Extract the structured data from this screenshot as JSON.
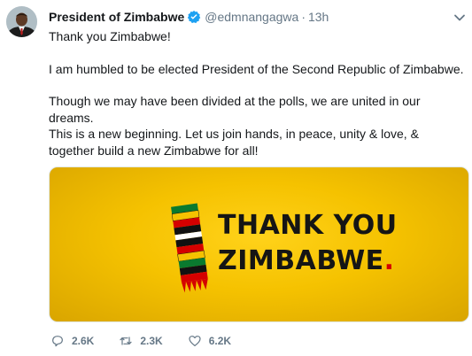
{
  "tweet": {
    "author": {
      "display_name": "President of Zimbabwe",
      "handle": "@edmnangagwa",
      "verified": true
    },
    "separator": "·",
    "time": "13h",
    "paragraphs": [
      "Thank you Zimbabwe!",
      "I am humbled to be elected President of the Second Republic of Zimbabwe.",
      "Though we may have been divided at the polls, we are united in our dreams.",
      "This is a new beginning. Let us join hands, in peace, unity & love, & together build a new Zimbabwe for all!"
    ],
    "media": {
      "line1": "THANK YOU",
      "line2": "ZIMBABWE",
      "line2_dot": ".",
      "background_color": "#f5c200",
      "accent_color": "#d40000"
    },
    "actions": {
      "replies": "2.6K",
      "retweets": "2.3K",
      "likes": "6.2K"
    }
  },
  "colors": {
    "text": "#14171a",
    "muted": "#657786",
    "verified_blue": "#1da1f2"
  },
  "icons": [
    "verified-badge-icon",
    "chevron-down-icon",
    "reply-icon",
    "retweet-icon",
    "like-icon"
  ]
}
